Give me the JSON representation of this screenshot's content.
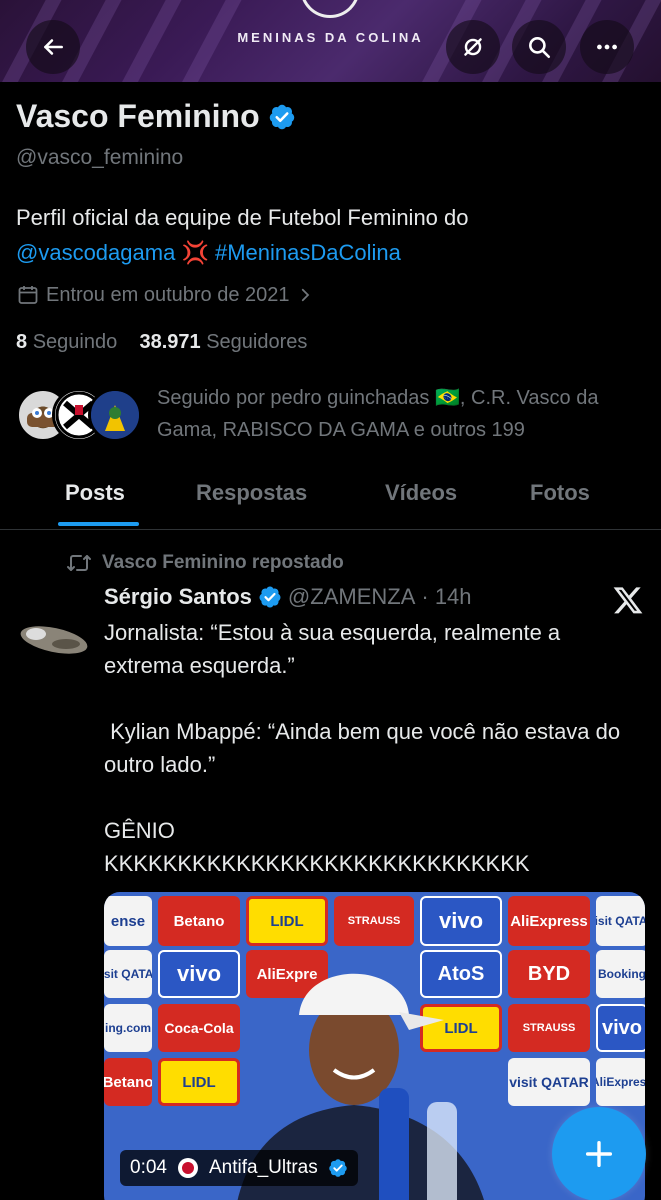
{
  "banner": {
    "text": "MENINAS DA COLINA"
  },
  "profile": {
    "name": "Vasco Feminino",
    "handle": "@vasco_feminino",
    "bio_text": "Perfil oficial da equipe de Futebol Feminino do",
    "bio_mention": "@vascodagama",
    "bio_emoji": "💢",
    "bio_hashtag": "#MeninasDaColina",
    "joined": "Entrou em outubro de 2021",
    "following_count": "8",
    "following_label": "Seguindo",
    "followers_count": "38.971",
    "followers_label": "Seguidores",
    "followed_by": "Seguido por pedro guinchadas 🇧🇷, C.R. Vasco da Gama, RABISCO DA GAMA e outros 199"
  },
  "tabs": [
    "Posts",
    "Respostas",
    "Vídeos",
    "Fotos"
  ],
  "post": {
    "repost_label": "Vasco Feminino repostado",
    "author_name": "Sérgio Santos",
    "author_handle": "@ZAMENZA",
    "time": "· 14h",
    "text": "Jornalista: “Estou à sua esquerda, realmente a extrema esquerda.”\n\n Kylian Mbappé: “Ainda bem que você não estava do outro lado.”\n\nGÊNIO\nKKKKKKKKKKKKKKKKKKKKKKKKKKKKK",
    "video_time": "0:04",
    "video_source": "Antifa_Ultras"
  },
  "sponsors": {
    "betano": "Betano",
    "lidl": "LIDL",
    "strauss": "STRAUSS",
    "vivo": "vivo",
    "aliexpress": "AliExpress",
    "visitqatar": "visit QATAR",
    "atos": "AtoS",
    "byd": "BYD",
    "booking": "Booking",
    "coke": "Coca-Cola",
    "bookingcom": "ing.com",
    "aliexpre": "AliExpre",
    "ense": "ense"
  },
  "colors": {
    "accent": "#1d9bf0",
    "muted": "#71767b",
    "text": "#e7e9ea",
    "background": "#000000"
  }
}
